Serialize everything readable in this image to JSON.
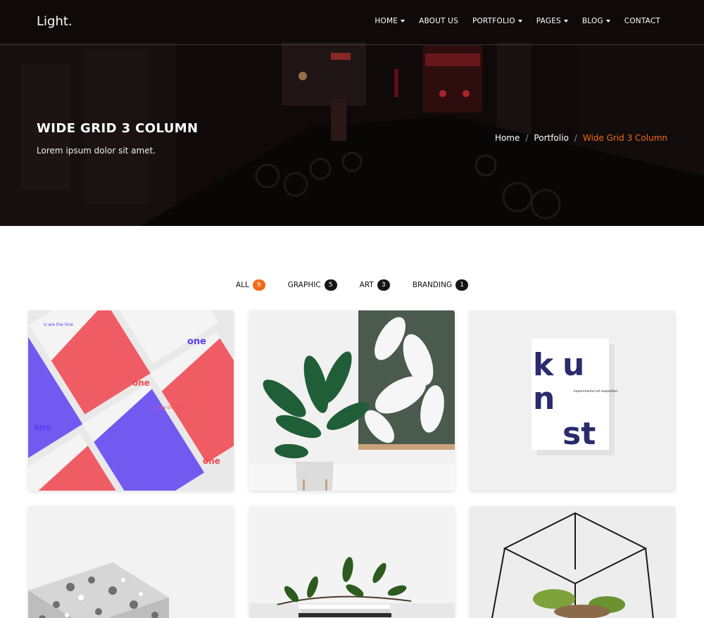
{
  "brand": "Light.",
  "nav": {
    "items": [
      {
        "label": "HOME",
        "dropdown": true
      },
      {
        "label": "ABOUT US",
        "dropdown": false
      },
      {
        "label": "PORTFOLIO",
        "dropdown": true
      },
      {
        "label": "PAGES",
        "dropdown": true
      },
      {
        "label": "BLOG",
        "dropdown": true
      },
      {
        "label": "CONTACT",
        "dropdown": false
      }
    ]
  },
  "hero": {
    "title": "WIDE GRID 3 COLUMN",
    "subtitle": "Lorem ipsum dolor sit amet.",
    "breadcrumb": {
      "home": "Home",
      "portfolio": "Portfolio",
      "current": "Wide Grid 3 Column"
    }
  },
  "filters": [
    {
      "label": "ALL",
      "count": "9",
      "active": true
    },
    {
      "label": "GRAPHIC",
      "count": "5",
      "active": false
    },
    {
      "label": "ART",
      "count": "3",
      "active": false
    },
    {
      "label": "BRANDING",
      "count": "1",
      "active": false
    }
  ],
  "portfolio": {
    "items": [
      {
        "image": "one-poster-image",
        "poster_word": "one",
        "poster_caption": "U are the One"
      },
      {
        "image": "plant-in-pot-image"
      },
      {
        "image": "kunst-poster-image",
        "poster_letters": [
          "k",
          "u",
          "n",
          "st"
        ],
        "poster_caption": "experimental art exposition"
      },
      {
        "image": "mosaic-box-image"
      },
      {
        "image": "branch-on-books-image"
      },
      {
        "image": "glass-terrarium-image"
      }
    ]
  },
  "colors": {
    "accent": "#f46a17",
    "badge_dark": "#151515",
    "poster_red": "#ef4b54",
    "poster_blue": "#5b3ef0"
  }
}
